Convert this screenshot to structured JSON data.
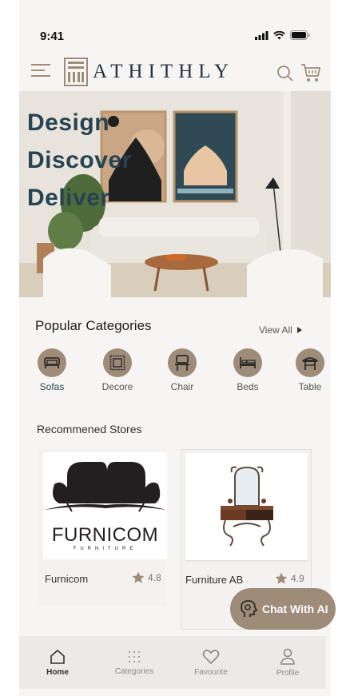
{
  "status": {
    "time": "9:41"
  },
  "header": {
    "brand": "ATHITHLY"
  },
  "hero": {
    "lines": [
      "Design",
      "Discover",
      "Deliver"
    ]
  },
  "categories": {
    "title": "Popular Categories",
    "view_all": "View All",
    "items": [
      {
        "label": "Sofas",
        "icon": "sofa-icon"
      },
      {
        "label": "Decore",
        "icon": "frame-icon"
      },
      {
        "label": "Chair",
        "icon": "chair-icon"
      },
      {
        "label": "Beds",
        "icon": "bed-icon"
      },
      {
        "label": "Table",
        "icon": "table-icon"
      }
    ]
  },
  "stores": {
    "title": "Recommened Stores",
    "items": [
      {
        "name": "Furnicom",
        "rating": "4.8",
        "logo_text": "FURNICOM",
        "logo_sub": "FURNITURE"
      },
      {
        "name": "Furniture AB",
        "rating": "4.9"
      }
    ]
  },
  "chat": {
    "label": "Chat With AI"
  },
  "nav": {
    "items": [
      {
        "label": "Home"
      },
      {
        "label": "Categories"
      },
      {
        "label": "Favourite"
      },
      {
        "label": "Profile"
      }
    ]
  },
  "colors": {
    "accent": "#9e8b78",
    "brand": "#25323d",
    "hero_text": "#264453"
  }
}
